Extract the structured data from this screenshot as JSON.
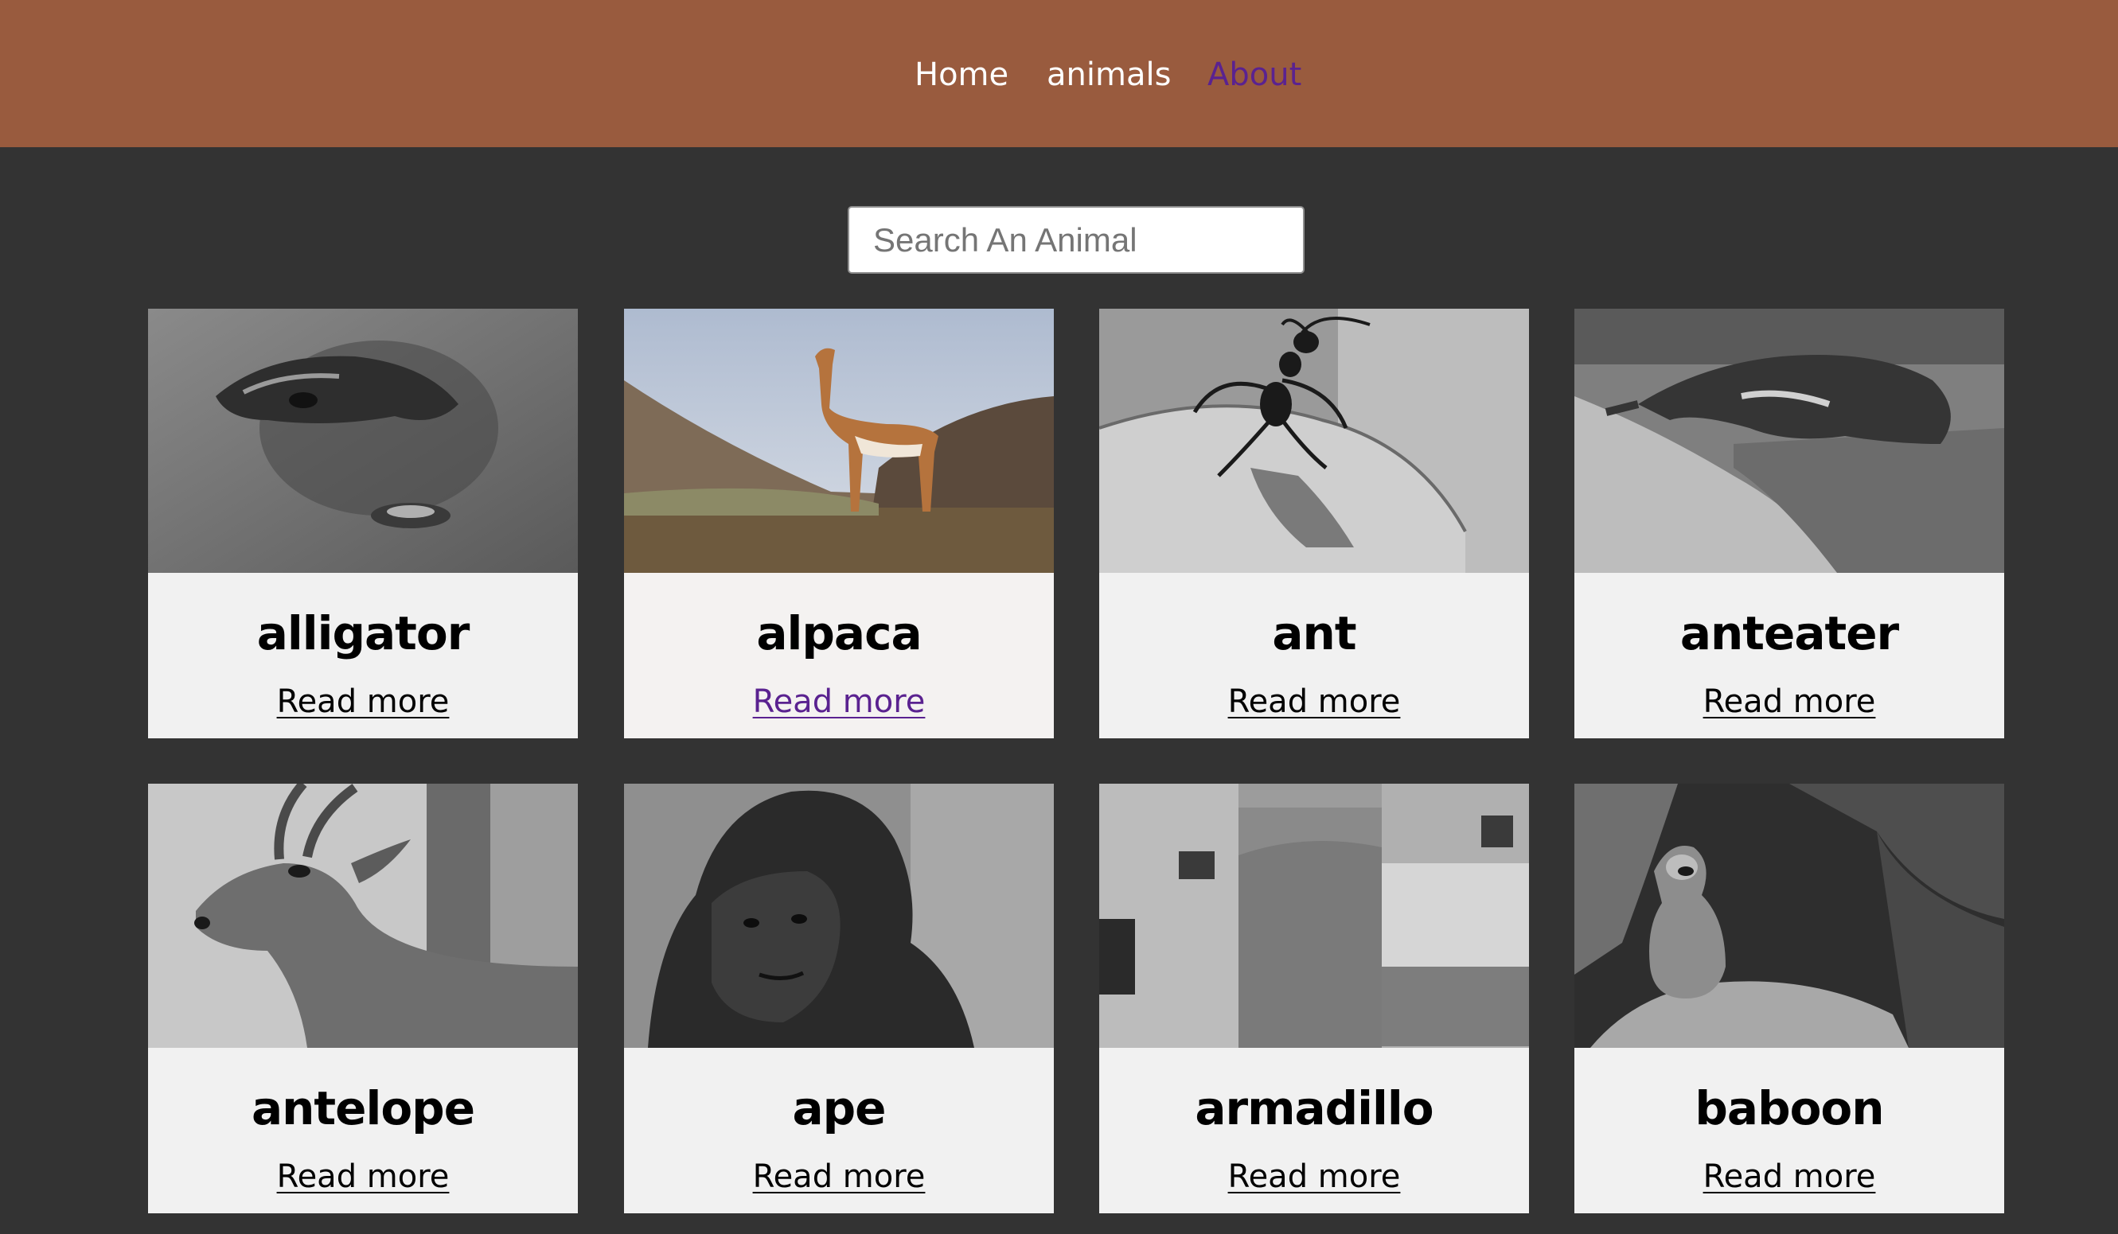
{
  "nav": {
    "items": [
      {
        "label": "Home"
      },
      {
        "label": "animals"
      },
      {
        "label": "About"
      }
    ]
  },
  "search": {
    "placeholder": "Search An Animal"
  },
  "cards": [
    {
      "name": "alligator",
      "link": "Read more"
    },
    {
      "name": "alpaca",
      "link": "Read more"
    },
    {
      "name": "ant",
      "link": "Read more"
    },
    {
      "name": "anteater",
      "link": "Read more"
    },
    {
      "name": "antelope",
      "link": "Read more"
    },
    {
      "name": "ape",
      "link": "Read more"
    },
    {
      "name": "armadillo",
      "link": "Read more"
    },
    {
      "name": "baboon",
      "link": "Read more"
    }
  ],
  "colors": {
    "header_bg": "#995b3e",
    "page_bg": "#333333",
    "card_bg": "#f1f1f1",
    "visited_link": "#5a2290"
  }
}
